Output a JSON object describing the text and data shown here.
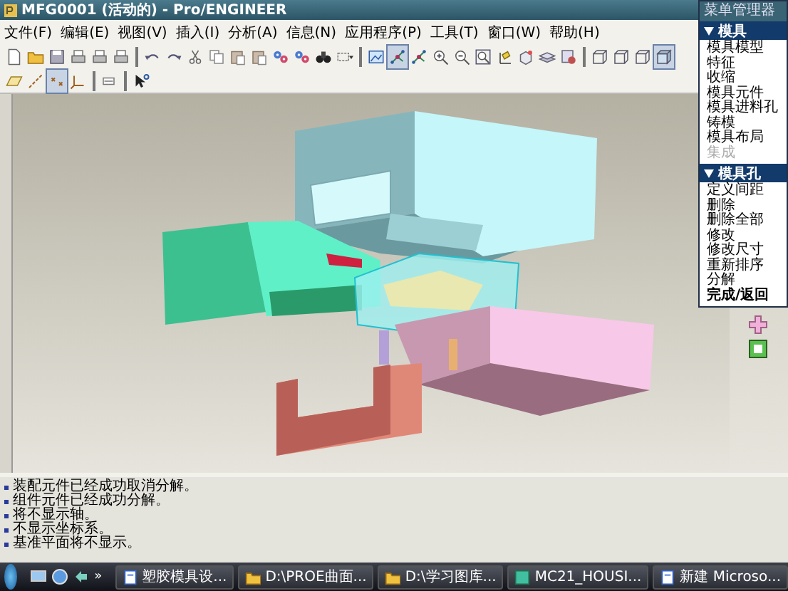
{
  "window": {
    "title": "MFG0001 (活动的) - Pro/ENGINEER"
  },
  "menu_bar": [
    "文件(F)",
    "编辑(E)",
    "视图(V)",
    "插入(I)",
    "分析(A)",
    "信息(N)",
    "应用程序(P)",
    "工具(T)",
    "窗口(W)",
    "帮助(H)"
  ],
  "toolbars": [
    {
      "buttons": [
        {
          "kind": "page",
          "pressed": false
        },
        {
          "kind": "folder",
          "pressed": false
        },
        {
          "kind": "floppy",
          "pressed": false
        },
        {
          "kind": "printer",
          "pressed": false
        },
        {
          "kind": "printer",
          "pressed": false
        },
        {
          "kind": "printer",
          "pressed": false
        },
        {
          "kind": "separator"
        },
        {
          "kind": "undo",
          "pressed": false
        },
        {
          "kind": "redo",
          "pressed": false
        },
        {
          "kind": "scissors",
          "pressed": false
        },
        {
          "kind": "copy",
          "pressed": false
        },
        {
          "kind": "paste",
          "pressed": false
        },
        {
          "kind": "paste",
          "pressed": false
        },
        {
          "kind": "gears",
          "pressed": false
        },
        {
          "kind": "gears",
          "pressed": false
        },
        {
          "kind": "binoculars",
          "pressed": false
        },
        {
          "kind": "select",
          "pressed": false
        },
        {
          "kind": "separator"
        },
        {
          "kind": "repaint",
          "pressed": false
        },
        {
          "kind": "nodes",
          "pressed": true
        },
        {
          "kind": "nodes",
          "pressed": false
        },
        {
          "kind": "zoomin",
          "pressed": false
        },
        {
          "kind": "zoomout",
          "pressed": false
        },
        {
          "kind": "zoomfit",
          "pressed": false
        },
        {
          "kind": "axes",
          "pressed": false
        },
        {
          "kind": "cube",
          "pressed": false
        },
        {
          "kind": "layers",
          "pressed": false
        },
        {
          "kind": "appearance",
          "pressed": false
        },
        {
          "kind": "separator"
        },
        {
          "kind": "wire",
          "pressed": false
        },
        {
          "kind": "wire",
          "pressed": false
        },
        {
          "kind": "wire",
          "pressed": false
        },
        {
          "kind": "shaded",
          "pressed": true
        }
      ]
    },
    {
      "buttons": [
        {
          "kind": "plane",
          "pressed": false
        },
        {
          "kind": "axis",
          "pressed": false
        },
        {
          "kind": "point",
          "pressed": true
        },
        {
          "kind": "csys",
          "pressed": false
        },
        {
          "kind": "separator"
        },
        {
          "kind": "annotation",
          "pressed": false
        },
        {
          "kind": "separator"
        },
        {
          "kind": "cursor",
          "pressed": false
        }
      ]
    }
  ],
  "menu_manager": {
    "title": "菜单管理器",
    "sections": [
      {
        "title": "模具",
        "expanded": true,
        "items": [
          {
            "label": "模具模型",
            "disabled": false,
            "default": false
          },
          {
            "label": "特征",
            "disabled": false,
            "default": false
          },
          {
            "label": "收缩",
            "disabled": false,
            "default": false
          },
          {
            "label": "模具元件",
            "disabled": false,
            "default": false
          },
          {
            "label": "模具进料孔",
            "disabled": false,
            "default": false
          },
          {
            "label": "铸模",
            "disabled": false,
            "default": false
          },
          {
            "label": "模具布局",
            "disabled": false,
            "default": false
          },
          {
            "label": "集成",
            "disabled": true,
            "default": false
          }
        ]
      },
      {
        "title": "模具孔",
        "expanded": true,
        "items": [
          {
            "label": "定义间距",
            "disabled": false,
            "default": false
          },
          {
            "label": "删除",
            "disabled": false,
            "default": false
          },
          {
            "label": "删除全部",
            "disabled": false,
            "default": false
          },
          {
            "label": "修改",
            "disabled": false,
            "default": false
          },
          {
            "label": "修改尺寸",
            "disabled": false,
            "default": false
          },
          {
            "label": "重新排序",
            "disabled": false,
            "default": false
          },
          {
            "label": "分解",
            "disabled": false,
            "default": false
          },
          {
            "label": "完成/返回",
            "disabled": false,
            "default": true
          }
        ]
      }
    ]
  },
  "messages": [
    "装配元件已经成功取消分解。",
    "组件元件已经成功分解。",
    "将不显示轴。",
    "不显示坐标系。",
    "基准平面将不显示。"
  ],
  "taskbar": {
    "buttons": [
      {
        "label": "塑胶模具设...",
        "kind": "document"
      },
      {
        "label": "D:\\PROE曲面...",
        "kind": "folder"
      },
      {
        "label": "D:\\学习图库...",
        "kind": "folder"
      },
      {
        "label": "MC21_HOUSI...",
        "kind": "app"
      },
      {
        "label": "新建 Microso...",
        "kind": "document"
      }
    ],
    "overflow": "»"
  }
}
